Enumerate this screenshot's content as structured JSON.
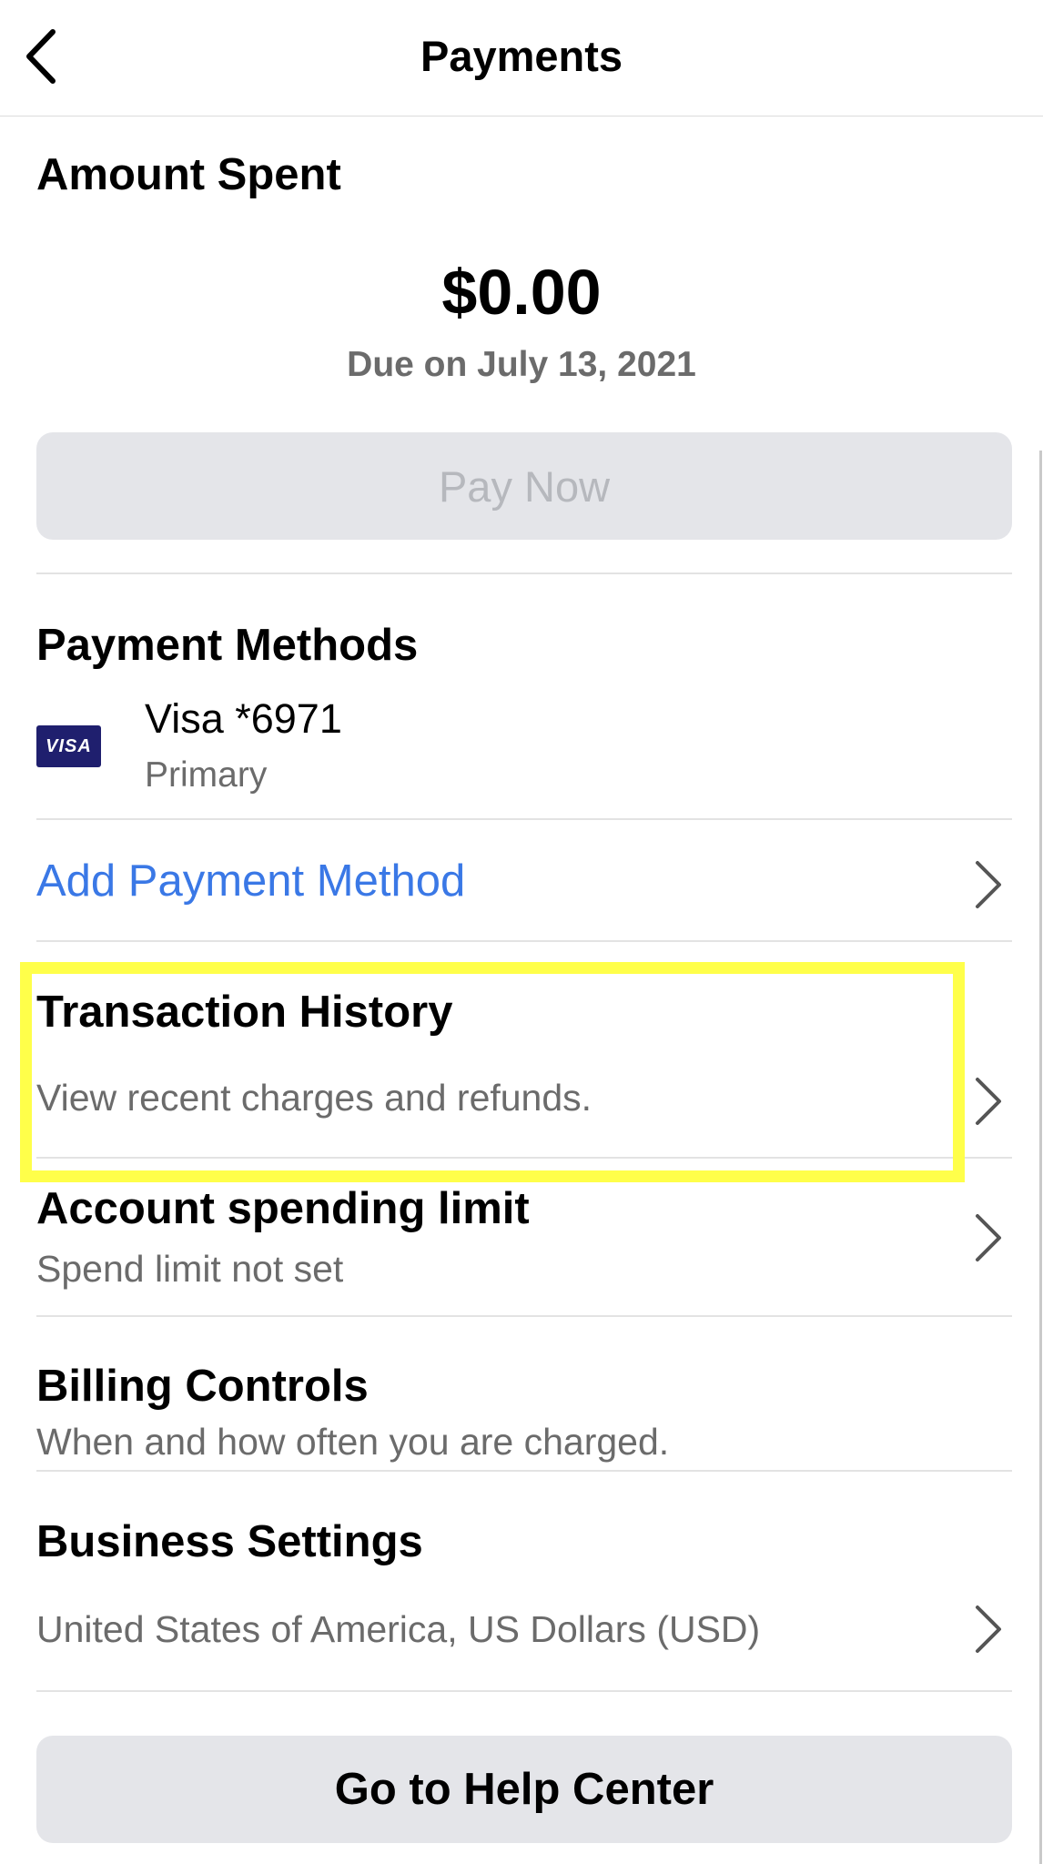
{
  "header": {
    "title": "Payments",
    "back_icon": "chevron-left-icon"
  },
  "amount_spent": {
    "title": "Amount Spent",
    "amount": "$0.00",
    "due": "Due on July 13, 2021",
    "pay_button": "Pay Now"
  },
  "payment_methods": {
    "title": "Payment Methods",
    "card": {
      "brand_logo": "VISA",
      "name": "Visa *6971",
      "status": "Primary"
    },
    "add_link": "Add Payment Method"
  },
  "transaction_history": {
    "title": "Transaction History",
    "subtitle": "View recent charges and refunds."
  },
  "spending_limit": {
    "title": "Account spending limit",
    "subtitle": "Spend limit not set"
  },
  "billing_controls": {
    "title": "Billing Controls",
    "subtitle": "When and how often you are charged."
  },
  "business_settings": {
    "title": "Business Settings",
    "subtitle": "United States of America, US Dollars (USD)"
  },
  "help_button": "Go to Help Center",
  "colors": {
    "link": "#3a78e6",
    "highlight": "#ffff4a",
    "button_bg": "#e4e5e9",
    "visa_bg": "#1f1f6e"
  }
}
